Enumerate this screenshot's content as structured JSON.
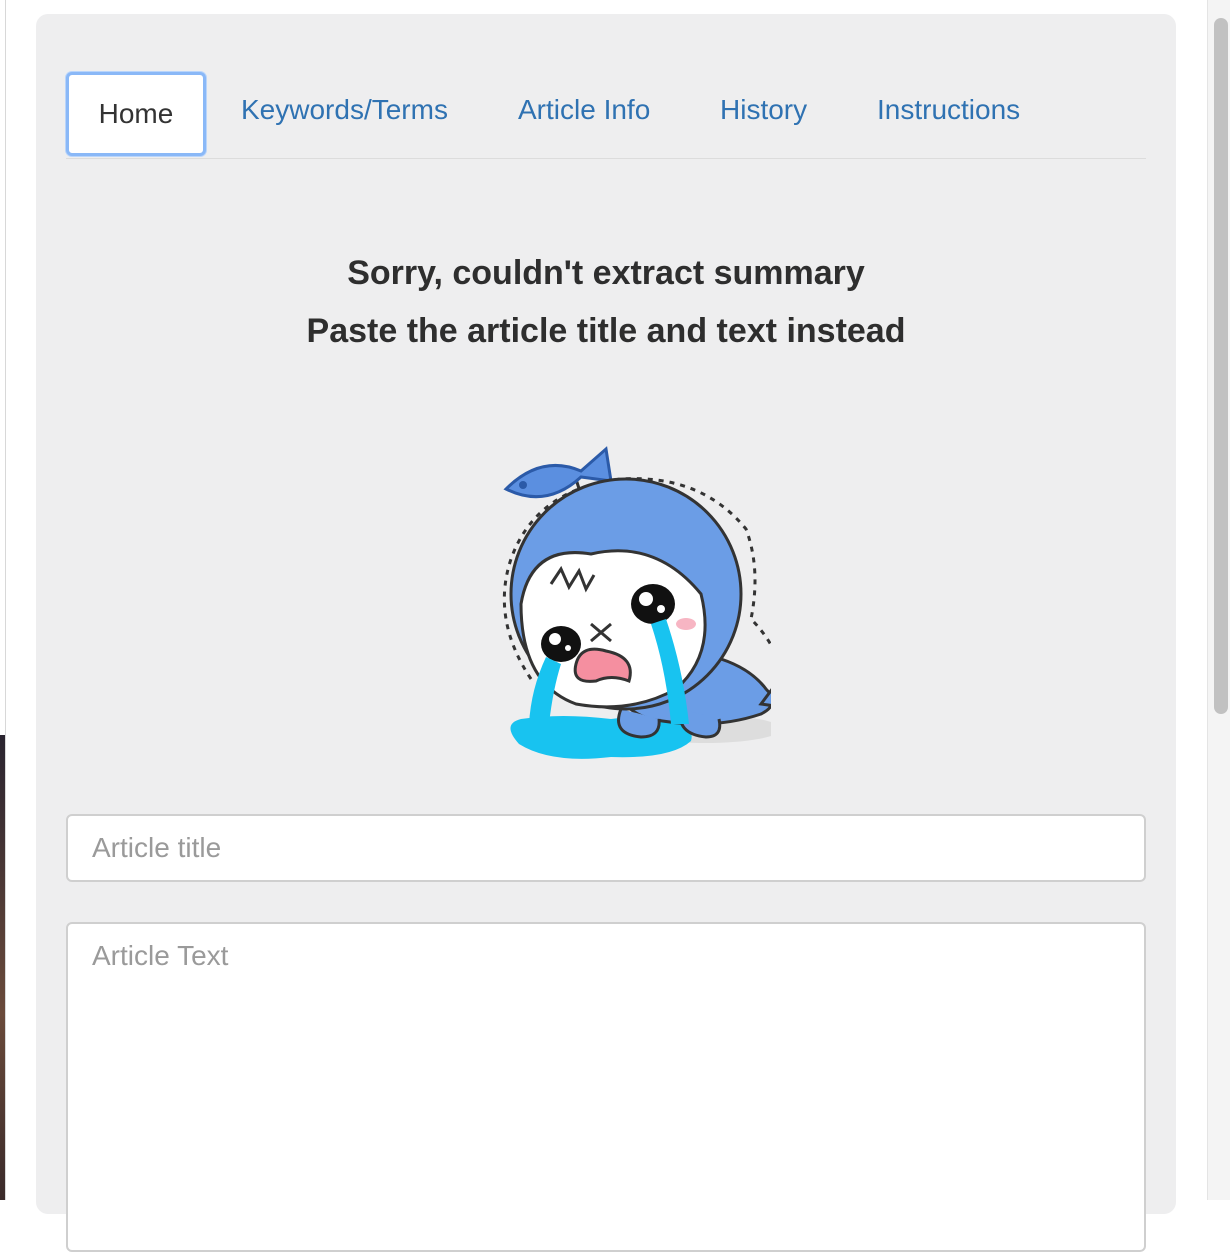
{
  "tabs": [
    {
      "label": "Home",
      "active": true
    },
    {
      "label": "Keywords/Terms",
      "active": false
    },
    {
      "label": "Article Info",
      "active": false
    },
    {
      "label": "History",
      "active": false
    },
    {
      "label": "Instructions",
      "active": false
    }
  ],
  "message": {
    "line1": "Sorry, couldn't extract summary",
    "line2": "Paste the article title and text instead"
  },
  "illustration": {
    "icon": "crying-shark-mascot-icon"
  },
  "form": {
    "title_placeholder": "Article title",
    "title_value": "",
    "text_placeholder": "Article Text",
    "text_value": ""
  },
  "colors": {
    "link": "#2f72b2",
    "active_tab_border": "#8ab8f7",
    "panel_bg": "#eeeeef",
    "heading": "#2e2e2e"
  }
}
